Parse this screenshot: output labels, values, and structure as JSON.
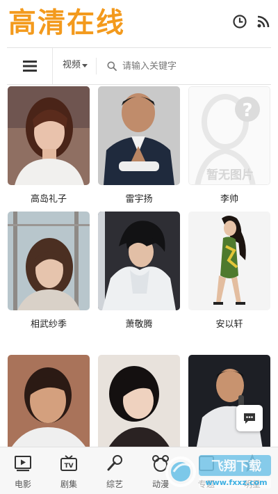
{
  "header": {
    "logo_text": "高清在线",
    "brand_color": "#f39a1d",
    "icons": [
      "clock-icon",
      "rss-icon"
    ]
  },
  "search": {
    "category_label": "视频",
    "placeholder": "请输入关键字"
  },
  "people": [
    {
      "name": "高岛礼子",
      "photo": "portrait"
    },
    {
      "name": "雷宇扬",
      "photo": "portrait"
    },
    {
      "name": "李帅",
      "photo": "no-image"
    },
    {
      "name": "相武纱季",
      "photo": "portrait"
    },
    {
      "name": "萧敬腾",
      "photo": "portrait"
    },
    {
      "name": "安以轩",
      "photo": "portrait"
    },
    {
      "name": "",
      "photo": "portrait"
    },
    {
      "name": "",
      "photo": "portrait"
    },
    {
      "name": "",
      "photo": "portrait"
    }
  ],
  "no_image_text": "暂无图片",
  "bottom_nav": [
    {
      "label": "电影",
      "icon": "movie-icon"
    },
    {
      "label": "剧集",
      "icon": "tv-icon"
    },
    {
      "label": "综艺",
      "icon": "microphone-icon"
    },
    {
      "label": "动漫",
      "icon": "cartoon-icon"
    },
    {
      "label": "专题",
      "icon": "topic-icon"
    },
    {
      "label": "明星",
      "icon": "star-icon"
    }
  ],
  "watermark": {
    "text": "飞翔下载",
    "sub": "www.fxxz.com"
  }
}
